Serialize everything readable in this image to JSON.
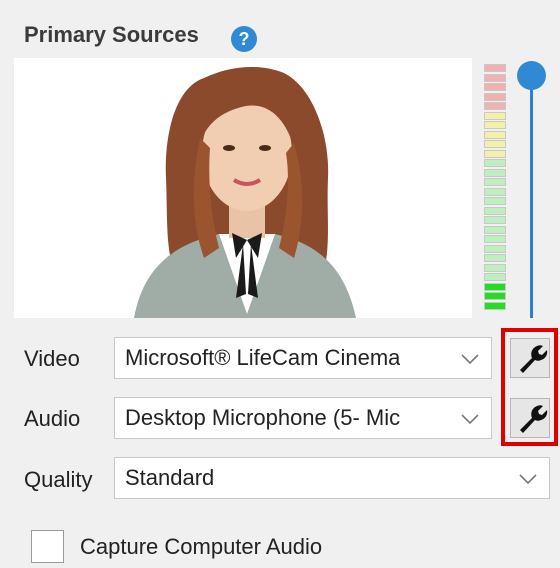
{
  "panel": {
    "title": "Primary Sources",
    "help_icon": "?"
  },
  "preview": {
    "meter_levels": [
      "red",
      "red",
      "red",
      "red",
      "red",
      "yellow",
      "yellow",
      "yellow",
      "yellow",
      "yellow",
      "green",
      "green",
      "green",
      "green",
      "green",
      "green",
      "green",
      "green",
      "green",
      "green",
      "green",
      "green",
      "green",
      "bright-green",
      "bright-green",
      "bright-green"
    ],
    "meter_colors": {
      "red": "#f0b1b1",
      "yellow": "#f3f0a8",
      "green": "#bfeebf",
      "bright-green": "#22dd22"
    }
  },
  "volume": {
    "level": 1.0
  },
  "video": {
    "label": "Video",
    "selected": "Microsoft® LifeCam Cinema"
  },
  "audio": {
    "label": "Audio",
    "selected": "Desktop Microphone (5- Mic"
  },
  "quality": {
    "label": "Quality",
    "selected": "Standard"
  },
  "capture_audio": {
    "label": "Capture Computer Audio",
    "checked": false
  },
  "colors": {
    "accent": "#2f8ad3",
    "highlight": "#e00000"
  }
}
